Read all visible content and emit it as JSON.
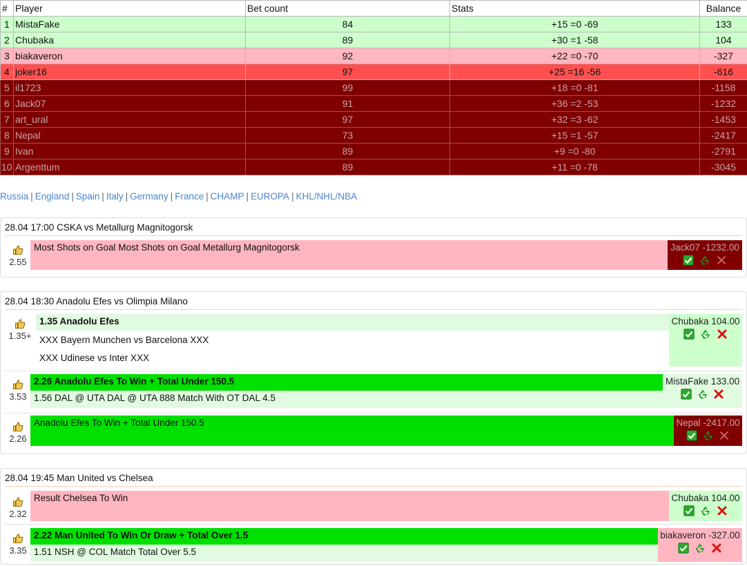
{
  "leaderboard": {
    "headers": {
      "num": "#",
      "player": "Player",
      "bets": "Bet count",
      "stats": "Stats",
      "balance": "Balance"
    },
    "rows": [
      {
        "num": "1",
        "player": "MistaFake",
        "bets": "84",
        "stats": "+15 =0 -69",
        "balance": "133",
        "tone": "green"
      },
      {
        "num": "2",
        "player": "Chubaka",
        "bets": "89",
        "stats": "+30 =1 -58",
        "balance": "104",
        "tone": "green"
      },
      {
        "num": "3",
        "player": "biakaveron",
        "bets": "92",
        "stats": "+22 =0 -70",
        "balance": "-327",
        "tone": "pink"
      },
      {
        "num": "4",
        "player": "joker16",
        "bets": "97",
        "stats": "+25 =16 -56",
        "balance": "-616",
        "tone": "red"
      },
      {
        "num": "5",
        "player": "il1723",
        "bets": "99",
        "stats": "+18 =0 -81",
        "balance": "-1158",
        "tone": "dark"
      },
      {
        "num": "6",
        "player": "Jack07",
        "bets": "91",
        "stats": "+36 =2 -53",
        "balance": "-1232",
        "tone": "dark"
      },
      {
        "num": "7",
        "player": "art_ural",
        "bets": "97",
        "stats": "+32 =3 -62",
        "balance": "-1453",
        "tone": "dark"
      },
      {
        "num": "8",
        "player": "Nepal",
        "bets": "73",
        "stats": "+15 =1 -57",
        "balance": "-2417",
        "tone": "dark"
      },
      {
        "num": "9",
        "player": "Ivan",
        "bets": "89",
        "stats": "+9 =0 -80",
        "balance": "-2791",
        "tone": "dark"
      },
      {
        "num": "10",
        "player": "Argenttum",
        "bets": "89",
        "stats": "+11 =0 -78",
        "balance": "-3045",
        "tone": "dark"
      }
    ]
  },
  "nav": {
    "leagues": [
      "Russia",
      "England",
      "Spain",
      "Italy",
      "Germany",
      "France",
      "CHAMP",
      "EUROPA",
      "KHL/NHL/NBA"
    ],
    "separator": "|"
  },
  "icons": {
    "like": "thumbs-up-icon",
    "accept": "check-icon",
    "recycle": "recycle-icon",
    "reject": "cross-icon"
  },
  "colors": {
    "green_row": "#ccffcc",
    "pink_row": "#ffb6c1",
    "red_row": "#ff5050",
    "dark_row": "#800000",
    "link": "#4a86c8",
    "bright_green": "#00e000"
  },
  "matches": [
    {
      "title": "28.04 17:00 CSKA vs Metallurg Magnitogorsk",
      "bets": [
        {
          "odds": "2.55",
          "lines": [
            "Most Shots on Goal Most Shots on Goal Metallurg Magnitogorsk"
          ],
          "owner": "Jack07 -1232.00"
        }
      ]
    },
    {
      "title": "28.04 18:30 Anadolu Efes vs Olimpia Milano",
      "bets": [
        {
          "odds": "1.35+",
          "lines": [
            "1.35 Anadolu Efes",
            "XXX Bayern Munchen vs Barcelona XXX",
            "XXX Udinese vs Inter XXX"
          ],
          "owner": "Chubaka 104.00"
        },
        {
          "odds": "3.53",
          "lines": [
            "2.26 Anadolu Efes To Win + Total Under 150.5",
            "1.56 DAL @ UTA DAL @ UTA 888 Match With OT DAL 4.5"
          ],
          "owner": "MistaFake 133.00"
        },
        {
          "odds": "2.26",
          "lines": [
            "Anadolu Efes To Win + Total Under 150.5"
          ],
          "owner": "Nepal -2417.00"
        }
      ]
    },
    {
      "title": "28.04 19:45 Man United vs Chelsea",
      "bets": [
        {
          "odds": "2.32",
          "lines": [
            "Result Chelsea To Win"
          ],
          "owner": "Chubaka 104.00"
        },
        {
          "odds": "3.35",
          "lines": [
            "2.22 Man United To Win Or Draw + Total Over 1.5",
            "1.51 NSH @ COL Match Total Over 5.5"
          ],
          "owner": "biakaveron -327.00"
        }
      ]
    }
  ]
}
